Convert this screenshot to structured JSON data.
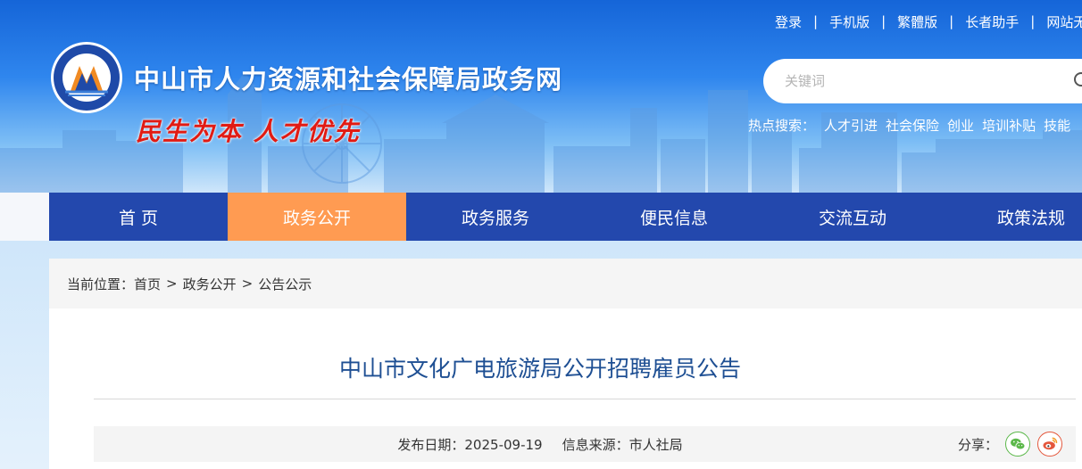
{
  "top_links": [
    "登录",
    "手机版",
    "繁體版",
    "长者助手",
    "网站无"
  ],
  "site": {
    "title": "中山市人力资源和社会保障局政务网",
    "slogan": "民生为本 人才优先"
  },
  "search": {
    "placeholder": "关键词"
  },
  "hot_search": {
    "label": "热点搜索：",
    "items": [
      "人才引进",
      "社会保险",
      "创业",
      "培训补贴",
      "技能"
    ]
  },
  "nav": {
    "items": [
      "首 页",
      "政务公开",
      "政务服务",
      "便民信息",
      "交流互动",
      "政策法规"
    ],
    "active_index": 1
  },
  "breadcrumb": {
    "prefix": "当前位置：",
    "items": [
      "首页",
      "政务公开",
      "公告公示"
    ],
    "separator": ">"
  },
  "article": {
    "title": "中山市文化广电旅游局公开招聘雇员公告",
    "date_label": "发布日期：2025-09-19",
    "source_label": "信息来源：市人社局",
    "share_label": "分享："
  },
  "icons": [
    "search-icon",
    "wechat-icon",
    "weibo-icon"
  ],
  "colors": {
    "nav_bg": "#2348ad",
    "nav_active": "#ff9b52",
    "title_text": "#1e4f93",
    "slogan": "#e11b14"
  }
}
